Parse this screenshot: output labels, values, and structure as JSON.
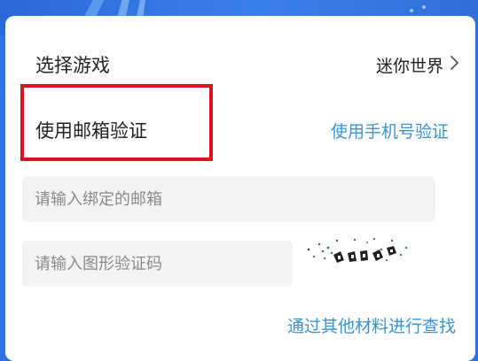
{
  "form": {
    "select_game_label": "选择游戏",
    "select_game_value": "迷你世界",
    "email_verify_label": "使用邮箱验证",
    "phone_verify_link": "使用手机号验证",
    "email_input": {
      "placeholder": "请输入绑定的邮箱",
      "value": ""
    },
    "captcha_input": {
      "placeholder": "请输入图形验证码",
      "value": ""
    },
    "other_materials_link": "通过其他材料进行查找"
  },
  "icons": {
    "chevron": "chevron-right-icon",
    "captcha": "captcha-image"
  },
  "colors": {
    "banner": "#2f72e0",
    "link": "#3a93d8",
    "highlight": "#d7131c",
    "input_bg": "#f2f3f5"
  }
}
